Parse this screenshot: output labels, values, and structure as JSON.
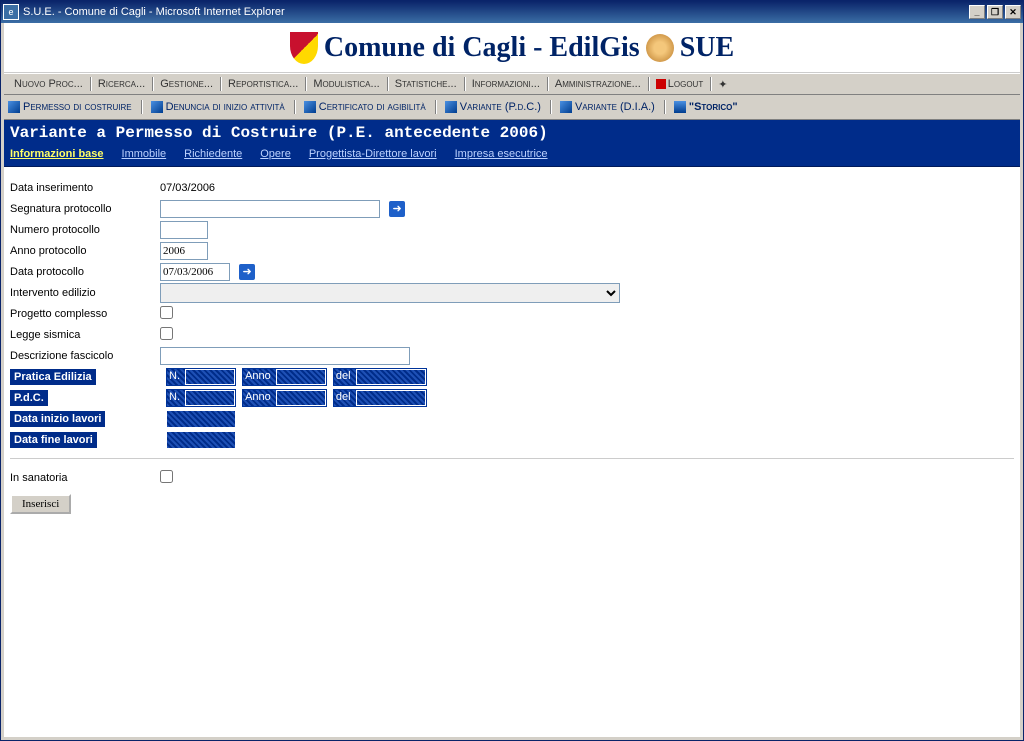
{
  "window": {
    "title": "S.U.E. - Comune di Cagli - Microsoft Internet Explorer"
  },
  "banner": {
    "text_a": "Comune di Cagli - EdilGis",
    "text_b": "SUE"
  },
  "menu": {
    "items": [
      "Nuovo Proc...",
      "Ricerca...",
      "Gestione...",
      "Reportistica...",
      "Modulistica...",
      "Statistiche...",
      "Informazioni...",
      "Amministrazione..."
    ],
    "logout": "Logout"
  },
  "tabs": {
    "items": [
      "Permesso di costruire",
      "Denuncia di inizio attività",
      "Certificato di agibilità",
      "Variante (P.d.C.)",
      "Variante (D.I.A.)",
      "\"Storico\""
    ]
  },
  "page_title": "Variante a Permesso di Costruire (P.E. antecedente 2006)",
  "subnav": {
    "items": [
      "Informazioni base",
      "Immobile",
      "Richiedente",
      "Opere",
      "Progettista-Direttore lavori",
      "Impresa esecutrice"
    ],
    "active": 0
  },
  "form": {
    "labels": {
      "data_inserimento": "Data inserimento",
      "segnatura_protocollo": "Segnatura protocollo",
      "numero_protocollo": "Numero protocollo",
      "anno_protocollo": "Anno protocollo",
      "data_protocollo": "Data protocollo",
      "intervento_edilizio": "Intervento edilizio",
      "progetto_complesso": "Progetto complesso",
      "legge_sismica": "Legge sismica",
      "descrizione_fascicolo": "Descrizione fascicolo",
      "pratica_edilizia": "Pratica Edilizia",
      "pdc": "P.d.C.",
      "data_inizio_lavori": "Data inizio lavori",
      "data_fine_lavori": "Data fine lavori",
      "in_sanatoria": "In sanatoria"
    },
    "sub_labels": {
      "n": "N.",
      "anno": "Anno",
      "del": "del"
    },
    "values": {
      "data_inserimento": "07/03/2006",
      "segnatura_protocollo": "",
      "numero_protocollo": "",
      "anno_protocollo": "2006",
      "data_protocollo": "07/03/2006",
      "intervento_edilizio": "",
      "progetto_complesso": false,
      "legge_sismica": false,
      "descrizione_fascicolo": "",
      "pratica_n": "",
      "pratica_anno": "",
      "pratica_del": "",
      "pdc_n": "",
      "pdc_anno": "",
      "pdc_del": "",
      "data_inizio_lavori": "",
      "data_fine_lavori": "",
      "in_sanatoria": false
    },
    "submit": "Inserisci"
  }
}
